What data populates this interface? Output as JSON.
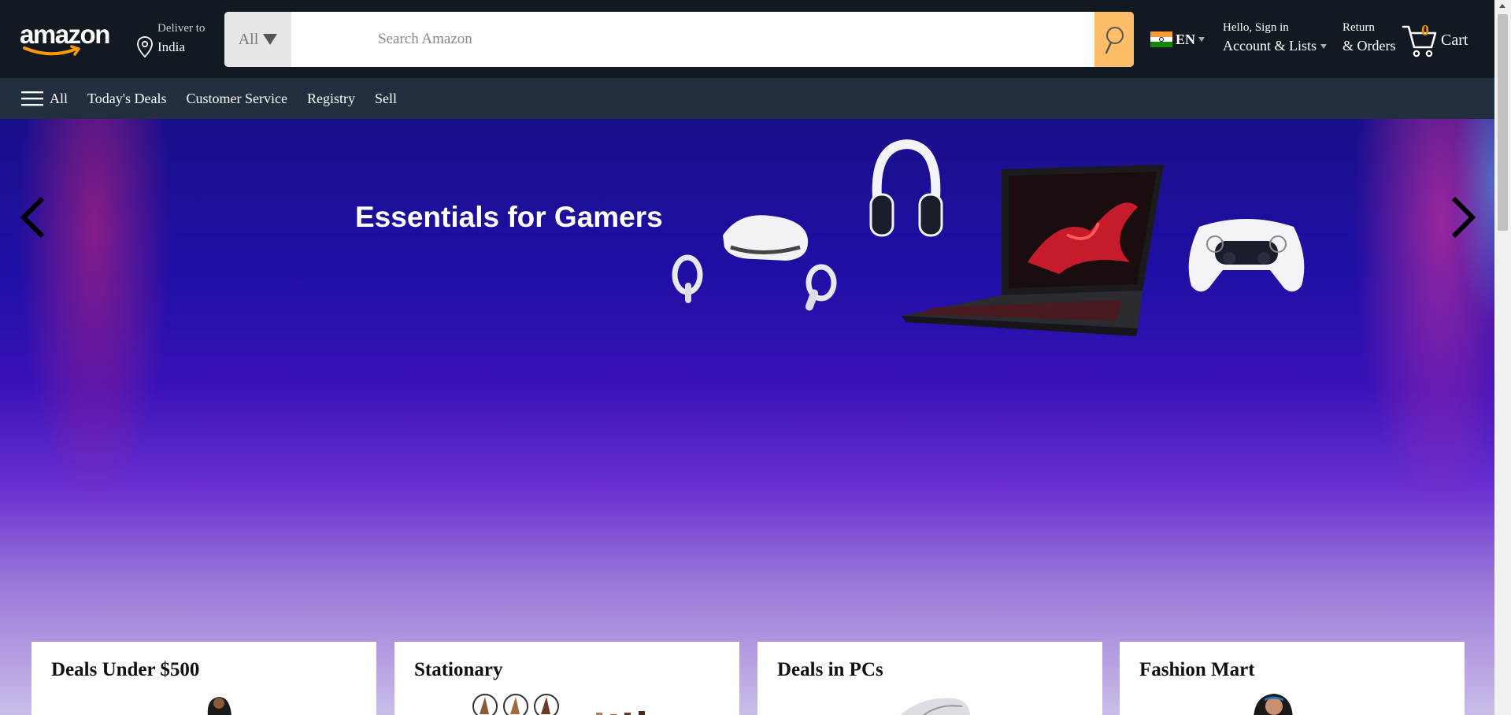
{
  "header": {
    "logo_text": "amazon",
    "deliver": {
      "line1": "Deliver to",
      "line2": "India"
    },
    "search": {
      "category": "All",
      "placeholder": "Search Amazon"
    },
    "language": {
      "code": "EN"
    },
    "account": {
      "line1": "Hello, Sign in",
      "line2": "Account & Lists"
    },
    "orders": {
      "line1": "Return",
      "line2": "& Orders"
    },
    "cart": {
      "count": "0",
      "label": "Cart"
    }
  },
  "subnav": {
    "all_label": "All",
    "items": [
      "Today's Deals",
      "Customer Service",
      "Registry",
      "Sell"
    ]
  },
  "hero": {
    "title": "Essentials for Gamers"
  },
  "cards": [
    {
      "title": "Deals Under $500"
    },
    {
      "title": "Stationary"
    },
    {
      "title": "Deals in PCs"
    },
    {
      "title": "Fashion Mart"
    }
  ],
  "colors": {
    "nav_bg": "#131921",
    "subnav_bg": "#232f3e",
    "search_button": "#febd69",
    "cart_count": "#f08804",
    "logo_smile": "#ff9900"
  },
  "icons": {
    "location": "location-pin-icon",
    "search": "search-icon",
    "cart": "cart-icon",
    "menu": "hamburger-menu-icon",
    "prev": "chevron-left-icon",
    "next": "chevron-right-icon"
  }
}
